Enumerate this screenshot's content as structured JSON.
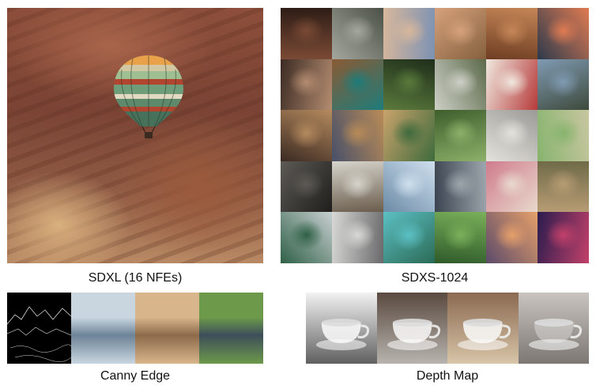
{
  "captions": {
    "left_top": "SDXL (16 NFEs)",
    "right_top": "SDXS-1024",
    "left_bottom": "Canny Edge",
    "right_bottom": "Depth Map"
  },
  "colors": {
    "canyon": "#8d4f3b",
    "balloon_stripe_green": "#6f9d7a",
    "balloon_stripe_red": "#b2452f",
    "edge_bg": "#000000",
    "edge_line": "#dcdcdc"
  },
  "grid_cells": [
    {
      "name": "woman-portrait",
      "c1": "#7a4a35",
      "c2": "#2e1d16"
    },
    {
      "name": "white-horse",
      "c1": "#a5a79f",
      "c2": "#4b5146"
    },
    {
      "name": "horse-rider-desert",
      "c1": "#d8b79b",
      "c2": "#7c92b3"
    },
    {
      "name": "orange-car-desert",
      "c1": "#d6a27c",
      "c2": "#85603e"
    },
    {
      "name": "apple-on-wood",
      "c1": "#c58657",
      "c2": "#6e3d22"
    },
    {
      "name": "mountain-lake-sunset",
      "c1": "#e07b52",
      "c2": "#2c3a4c"
    },
    {
      "name": "medusa-portrait",
      "c1": "#b48c70",
      "c2": "#3c2b24"
    },
    {
      "name": "dog-with-ball",
      "c1": "#1e7c7a",
      "c2": "#8a5a34"
    },
    {
      "name": "rider-in-forest",
      "c1": "#5a7a3c",
      "c2": "#1f2e1a"
    },
    {
      "name": "jeep-on-road",
      "c1": "#cdd0c7",
      "c2": "#5c6a4a"
    },
    {
      "name": "strawberries-bowl",
      "c1": "#f0e8df",
      "c2": "#b63a3a"
    },
    {
      "name": "castle-on-cliff",
      "c1": "#7f9ab2",
      "c2": "#3d4a3b"
    },
    {
      "name": "blonde-warrior",
      "c1": "#b58a5e",
      "c2": "#3b2a22"
    },
    {
      "name": "lion-savanna",
      "c1": "#b98b57",
      "c2": "#48506a"
    },
    {
      "name": "forest-fairy",
      "c1": "#3e6a3c",
      "c2": "#c9a36c"
    },
    {
      "name": "green-valley-car",
      "c1": "#8db06a",
      "c2": "#3e5e2c"
    },
    {
      "name": "teacup",
      "c1": "#e4e2dc",
      "c2": "#9c9a96"
    },
    {
      "name": "green-hills",
      "c1": "#87b46e",
      "c2": "#c8c6a0"
    },
    {
      "name": "old-man-hat",
      "c1": "#5d5a55",
      "c2": "#1f1e1c"
    },
    {
      "name": "cat-by-window",
      "c1": "#d6d4cc",
      "c2": "#6a5c4c"
    },
    {
      "name": "penguins-ice",
      "c1": "#cfe0ee",
      "c2": "#6b8aa6"
    },
    {
      "name": "classic-car-street",
      "c1": "#9ea6ad",
      "c2": "#3b4450"
    },
    {
      "name": "pink-roses-vase",
      "c1": "#e8d9cc",
      "c2": "#d07b8c"
    },
    {
      "name": "village-landscape",
      "c1": "#b79c74",
      "c2": "#6f6a48"
    },
    {
      "name": "astronaut-jungle",
      "c1": "#2f6046",
      "c2": "#c8cfd1"
    },
    {
      "name": "robot-parts",
      "c1": "#d8d8d6",
      "c2": "#6a6a6c"
    },
    {
      "name": "floating-islands",
      "c1": "#5cc0c4",
      "c2": "#2b6a56"
    },
    {
      "name": "park-trees",
      "c1": "#7ab05a",
      "c2": "#2f5a2a"
    },
    {
      "name": "fantasy-towers-sunset",
      "c1": "#e6a06a",
      "c2": "#5b4a6a"
    },
    {
      "name": "neon-city",
      "c1": "#c2416a",
      "c2": "#2a1c4e"
    }
  ],
  "canny_panels": [
    {
      "name": "canny-edge-map",
      "c1": "#000000",
      "c2": "#111111"
    },
    {
      "name": "icy-mountains-lake",
      "c1": "#c9d6e0",
      "c2": "#6d8397"
    },
    {
      "name": "desert-dunes-peaks",
      "c1": "#d9b58c",
      "c2": "#8c6a4a"
    },
    {
      "name": "green-valley-mountains",
      "c1": "#6c9a4a",
      "c2": "#3e4e5a"
    }
  ],
  "depth_panels": [
    {
      "name": "depth-teacup-white",
      "c1": "#f2f2f2",
      "c2": "#606060"
    },
    {
      "name": "blue-pattern-teacup",
      "c1": "#5a4a40",
      "c2": "#b7b3ae"
    },
    {
      "name": "brown-teacup",
      "c1": "#8b6a52",
      "c2": "#d8c4a8"
    },
    {
      "name": "glass-teacup",
      "c1": "#c9c4bf",
      "c2": "#7c7772"
    }
  ]
}
